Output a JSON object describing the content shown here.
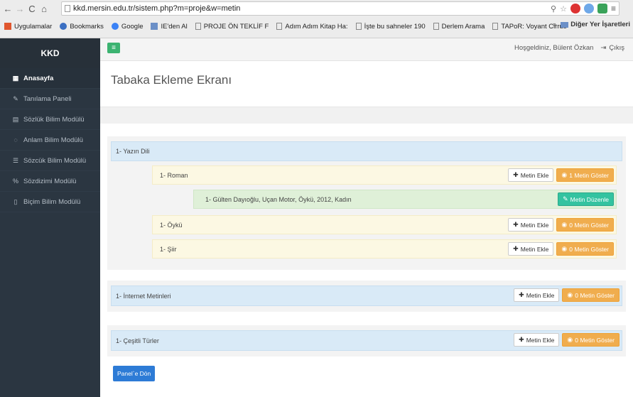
{
  "browser": {
    "url": "kkd.mersin.edu.tr/sistem.php?m=proje&w=metin",
    "bookmarks": [
      {
        "label": "Uygulamalar",
        "icon": "apps-grid-icon",
        "color": "#e0562e"
      },
      {
        "label": "Bookmarks",
        "icon": "star-icon",
        "color": "#3b6fc2"
      },
      {
        "label": "Google",
        "icon": "google-icon",
        "color": "#3b82f6"
      },
      {
        "label": "IE'den Al",
        "icon": "folder-icon",
        "color": "#6b8fc7"
      },
      {
        "label": "PROJE ÖN TEKLİF F",
        "icon": "page-icon",
        "color": "#888888"
      },
      {
        "label": "Adım Adım Kitap Ha:",
        "icon": "page-icon",
        "color": "#888888"
      },
      {
        "label": "İşte bu sahneler 190",
        "icon": "page-icon",
        "color": "#888888"
      },
      {
        "label": "Derlem Arama",
        "icon": "page-icon",
        "color": "#888888"
      },
      {
        "label": "TAPoR: Voyant Cirrus",
        "icon": "page-icon",
        "color": "#888888"
      }
    ],
    "more": "»",
    "other_bookmarks": "Diğer Yer İşaretleri"
  },
  "sidebar": {
    "brand": "KKD",
    "items": [
      {
        "label": "Anasayfa",
        "icon": "grid-icon",
        "glyph": "▦",
        "active": true
      },
      {
        "label": "Tanılama Paneli",
        "icon": "pencil-icon",
        "glyph": "✎",
        "active": false
      },
      {
        "label": "Sözlük Bilim Modülü",
        "icon": "book-icon",
        "glyph": "▤",
        "active": false
      },
      {
        "label": "Anlam Bilim Modülü",
        "icon": "circle-icon",
        "glyph": "◌",
        "active": false
      },
      {
        "label": "Sözcük Bilim Modülü",
        "icon": "list-icon",
        "glyph": "☰",
        "active": false
      },
      {
        "label": "Sözdizimi Modülü",
        "icon": "link-icon",
        "glyph": "%",
        "active": false
      },
      {
        "label": "Biçim Bilim Modülü",
        "icon": "file-icon",
        "glyph": "▯",
        "active": false
      }
    ]
  },
  "header": {
    "toggle_glyph": "≡",
    "greeting": "Hoşgeldiniz, Bülent Özkan",
    "logout": "Çıkış"
  },
  "main": {
    "title": "Tabaka Ekleme Ekranı",
    "back_button": "Panel`e Dön"
  },
  "tree": {
    "section1": {
      "label": "1- Yazın Dili",
      "children": [
        {
          "label": "1- Roman",
          "add": "Metin Ekle",
          "show": "1 Metin Göster"
        },
        {
          "label": "1- Öykü",
          "add": "Metin Ekle",
          "show": "0 Metin Göster"
        },
        {
          "label": "1- Şiir",
          "add": "Metin Ekle",
          "show": "0 Metin Göster"
        }
      ],
      "text_item": {
        "label": "1- Gülten Dayıoğlu, Uçan Motor, Öykü, 2012, Kadın",
        "edit": "Metin Düzenle"
      }
    },
    "section2": {
      "label": "1- İnternet Metinleri",
      "add": "Metin Ekle",
      "show": "0 Metin Göster"
    },
    "section3": {
      "label": "1- Çeşitli Türler",
      "add": "Metin Ekle",
      "show": "0 Metin Göster"
    }
  },
  "colors": {
    "sidebar": "#2b3641",
    "primary": "#2d7bd6",
    "warning": "#f0ad4e",
    "success": "#33c3a0",
    "toggle": "#3cb371"
  }
}
